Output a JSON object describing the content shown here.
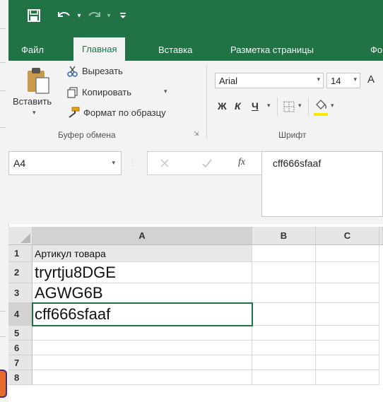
{
  "qat": {
    "save_icon": "save-icon",
    "undo_icon": "undo-icon",
    "redo_icon": "redo-icon",
    "customize_icon": "customize-qat-icon"
  },
  "tabs": [
    {
      "label": "Файл"
    },
    {
      "label": "Главная"
    },
    {
      "label": "Вставка"
    },
    {
      "label": "Разметка страницы"
    },
    {
      "label": "Фо"
    }
  ],
  "clipboard": {
    "paste_label": "Вставить",
    "cut_label": "Вырезать",
    "copy_label": "Копировать",
    "format_painter_label": "Формат по образцу",
    "group_label": "Буфер обмена"
  },
  "font": {
    "name": "Arial",
    "size": "14",
    "bold": "Ж",
    "italic": "К",
    "underline": "Ч",
    "grow_partial": "А",
    "group_label": "Шрифт",
    "fill_color": "#ffe600"
  },
  "formula_bar": {
    "name_box": "A4",
    "fx": "fx",
    "content": "cff666sfaaf"
  },
  "sheet": {
    "columns": [
      "A",
      "B",
      "C"
    ],
    "rows": [
      "1",
      "2",
      "3",
      "4",
      "5",
      "6",
      "7",
      "8"
    ],
    "a1": "Артикул товара",
    "a2": "tryrtju8DGE",
    "a3": "AGWG6B",
    "a4": "cff666sfaaf"
  },
  "colors": {
    "excel_green": "#217346",
    "ribbon_bg": "#f3f3f3"
  }
}
